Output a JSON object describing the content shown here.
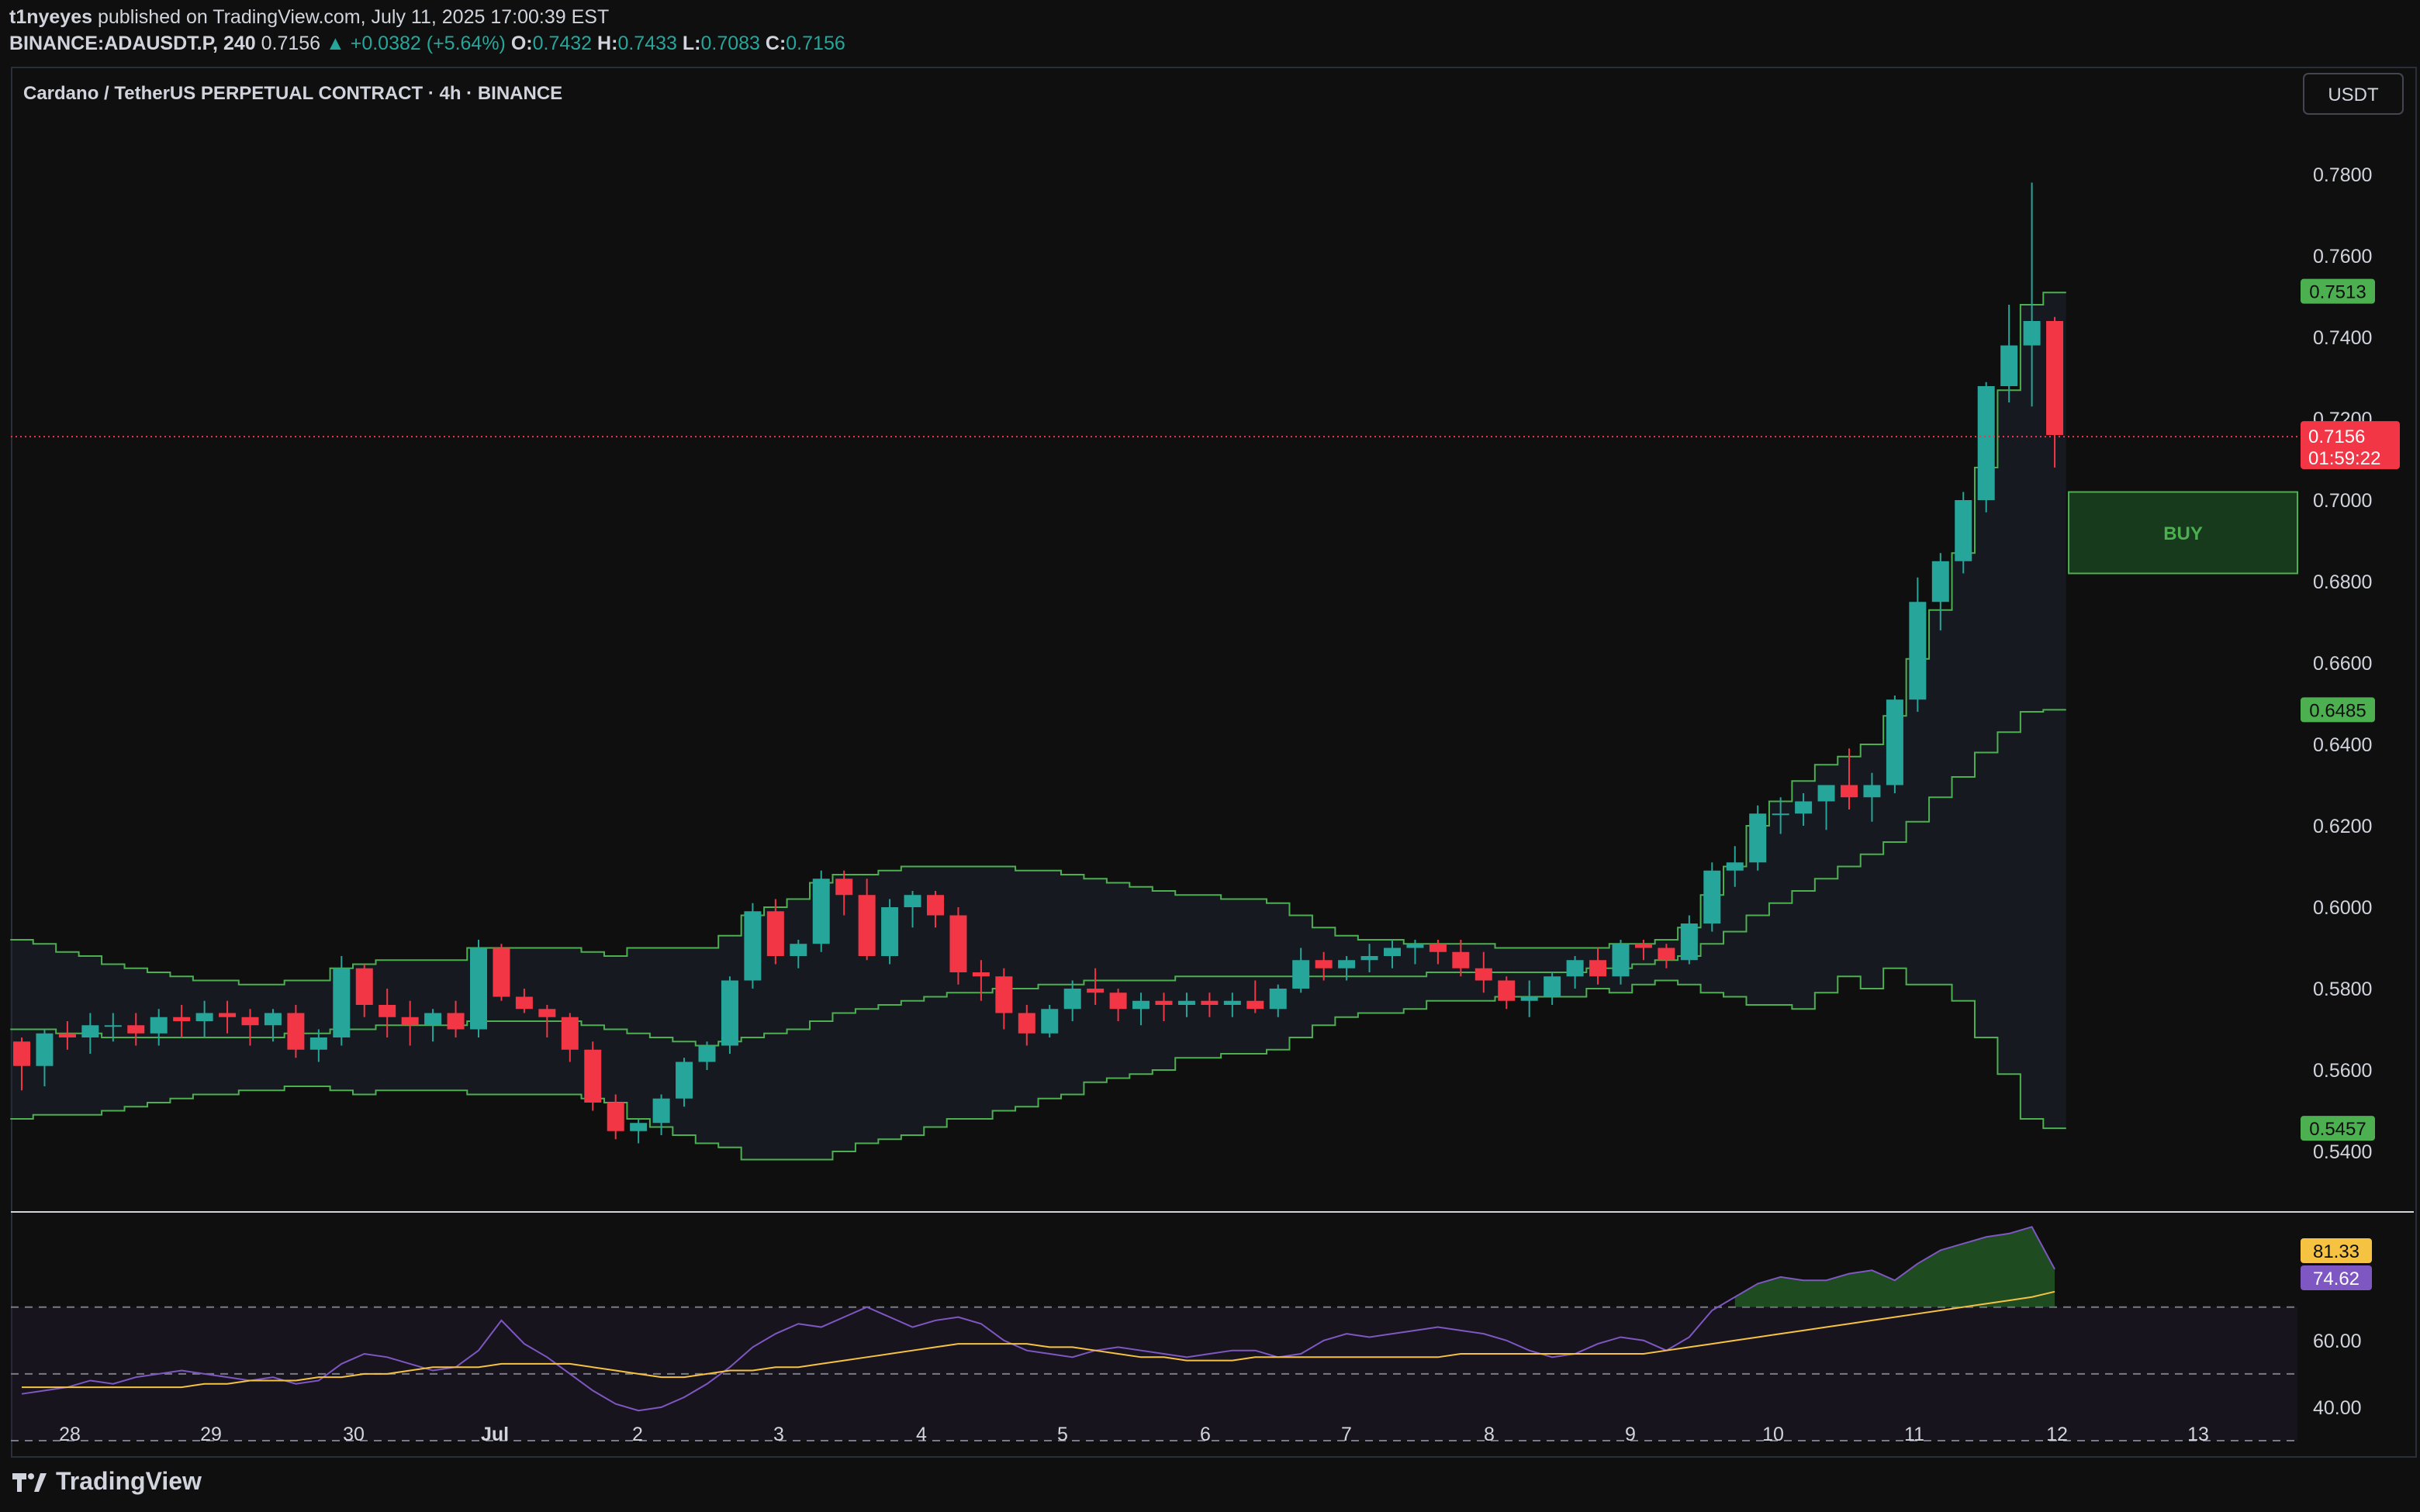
{
  "header": {
    "author": "t1nyeyes",
    "published": "published on TradingView.com, July 11, 2025 17:00:39 EST",
    "symbol_interval": "BINANCE:ADAUSDT.P, 240",
    "last": "0.7156",
    "change": "▲ +0.0382 (+5.64%)",
    "o_label": "O:",
    "o_value": "0.7432",
    "h_label": "H:",
    "h_value": "0.7433",
    "l_label": "L:",
    "l_value": "0.7083",
    "c_label": "C:",
    "c_value": "0.7156"
  },
  "pane_title": "Cardano / TetherUS PERPETUAL CONTRACT · 4h · BINANCE",
  "currency_button": "USDT",
  "price_scale": [
    "0.7800",
    "0.7600",
    "0.7400",
    "0.7200",
    "0.7000",
    "0.6800",
    "0.6600",
    "0.6400",
    "0.6200",
    "0.6000",
    "0.5800",
    "0.5600",
    "0.5400"
  ],
  "price_tags": {
    "upper_band": "0.7513",
    "last_price": "0.7156",
    "countdown": "01:59:22",
    "middle_band": "0.6485",
    "lower_band": "0.5457"
  },
  "buy_label": "BUY",
  "rsi_scale": [
    "60.00",
    "40.00"
  ],
  "rsi_tags": {
    "rsi": "81.33",
    "rsi_ma": "74.62"
  },
  "time_axis": [
    "28",
    "29",
    "30",
    "Jul",
    "2",
    "3",
    "4",
    "5",
    "6",
    "7",
    "8",
    "9",
    "10",
    "11",
    "12",
    "13"
  ],
  "footer": {
    "brand": "TradingView"
  },
  "colors": {
    "up": "#26a69a",
    "down": "#f23645",
    "band": "#4caf50",
    "rsi": "#7e57c2",
    "rsi_ma": "#f5c242",
    "background": "#0f0f0f"
  },
  "chart_data": [
    {
      "type": "candlestick",
      "title": "Cardano / TetherUS PERPETUAL CONTRACT · 4h · BINANCE",
      "ylim": [
        0.53,
        0.795
      ],
      "x_labels": [
        "28",
        "29",
        "30",
        "Jul",
        "2",
        "3",
        "4",
        "5",
        "6",
        "7",
        "8",
        "9",
        "10",
        "11",
        "12",
        "13"
      ],
      "candles": [
        [
          0.567,
          0.568,
          0.555,
          0.561
        ],
        [
          0.561,
          0.57,
          0.556,
          0.569
        ],
        [
          0.569,
          0.572,
          0.565,
          0.568
        ],
        [
          0.568,
          0.574,
          0.564,
          0.571
        ],
        [
          0.571,
          0.574,
          0.567,
          0.571
        ],
        [
          0.571,
          0.574,
          0.566,
          0.569
        ],
        [
          0.569,
          0.575,
          0.566,
          0.573
        ],
        [
          0.573,
          0.576,
          0.568,
          0.572
        ],
        [
          0.572,
          0.577,
          0.568,
          0.574
        ],
        [
          0.574,
          0.577,
          0.569,
          0.573
        ],
        [
          0.573,
          0.575,
          0.566,
          0.571
        ],
        [
          0.571,
          0.575,
          0.567,
          0.574
        ],
        [
          0.574,
          0.576,
          0.563,
          0.565
        ],
        [
          0.565,
          0.57,
          0.562,
          0.568
        ],
        [
          0.568,
          0.588,
          0.566,
          0.585
        ],
        [
          0.585,
          0.586,
          0.573,
          0.576
        ],
        [
          0.576,
          0.58,
          0.568,
          0.573
        ],
        [
          0.573,
          0.577,
          0.566,
          0.571
        ],
        [
          0.571,
          0.575,
          0.567,
          0.574
        ],
        [
          0.574,
          0.577,
          0.568,
          0.57
        ],
        [
          0.57,
          0.592,
          0.568,
          0.59
        ],
        [
          0.59,
          0.591,
          0.577,
          0.578
        ],
        [
          0.578,
          0.58,
          0.574,
          0.575
        ],
        [
          0.575,
          0.576,
          0.568,
          0.573
        ],
        [
          0.573,
          0.574,
          0.562,
          0.565
        ],
        [
          0.565,
          0.567,
          0.55,
          0.552
        ],
        [
          0.552,
          0.554,
          0.543,
          0.545
        ],
        [
          0.545,
          0.548,
          0.542,
          0.547
        ],
        [
          0.547,
          0.554,
          0.544,
          0.553
        ],
        [
          0.553,
          0.563,
          0.551,
          0.562
        ],
        [
          0.562,
          0.567,
          0.56,
          0.566
        ],
        [
          0.566,
          0.583,
          0.564,
          0.582
        ],
        [
          0.582,
          0.601,
          0.58,
          0.599
        ],
        [
          0.599,
          0.602,
          0.586,
          0.588
        ],
        [
          0.588,
          0.592,
          0.585,
          0.591
        ],
        [
          0.591,
          0.609,
          0.589,
          0.607
        ],
        [
          0.607,
          0.609,
          0.598,
          0.603
        ],
        [
          0.603,
          0.607,
          0.587,
          0.588
        ],
        [
          0.588,
          0.602,
          0.586,
          0.6
        ],
        [
          0.6,
          0.604,
          0.595,
          0.603
        ],
        [
          0.603,
          0.604,
          0.595,
          0.598
        ],
        [
          0.598,
          0.6,
          0.581,
          0.584
        ],
        [
          0.584,
          0.587,
          0.577,
          0.583
        ],
        [
          0.583,
          0.585,
          0.57,
          0.574
        ],
        [
          0.574,
          0.576,
          0.566,
          0.569
        ],
        [
          0.569,
          0.576,
          0.568,
          0.575
        ],
        [
          0.575,
          0.582,
          0.572,
          0.58
        ],
        [
          0.58,
          0.585,
          0.576,
          0.579
        ],
        [
          0.579,
          0.58,
          0.572,
          0.575
        ],
        [
          0.575,
          0.579,
          0.571,
          0.577
        ],
        [
          0.577,
          0.579,
          0.572,
          0.576
        ],
        [
          0.576,
          0.579,
          0.573,
          0.577
        ],
        [
          0.577,
          0.579,
          0.573,
          0.576
        ],
        [
          0.576,
          0.579,
          0.573,
          0.577
        ],
        [
          0.577,
          0.582,
          0.574,
          0.575
        ],
        [
          0.575,
          0.581,
          0.573,
          0.58
        ],
        [
          0.58,
          0.59,
          0.579,
          0.587
        ],
        [
          0.587,
          0.589,
          0.582,
          0.585
        ],
        [
          0.585,
          0.588,
          0.582,
          0.587
        ],
        [
          0.587,
          0.591,
          0.584,
          0.588
        ],
        [
          0.588,
          0.592,
          0.585,
          0.59
        ],
        [
          0.59,
          0.592,
          0.586,
          0.591
        ],
        [
          0.591,
          0.592,
          0.586,
          0.589
        ],
        [
          0.589,
          0.592,
          0.583,
          0.585
        ],
        [
          0.585,
          0.589,
          0.579,
          0.582
        ],
        [
          0.582,
          0.583,
          0.575,
          0.577
        ],
        [
          0.577,
          0.582,
          0.573,
          0.578
        ],
        [
          0.578,
          0.584,
          0.576,
          0.583
        ],
        [
          0.583,
          0.588,
          0.58,
          0.587
        ],
        [
          0.587,
          0.59,
          0.581,
          0.583
        ],
        [
          0.583,
          0.592,
          0.581,
          0.591
        ],
        [
          0.591,
          0.592,
          0.587,
          0.59
        ],
        [
          0.59,
          0.591,
          0.585,
          0.587
        ],
        [
          0.587,
          0.598,
          0.586,
          0.596
        ],
        [
          0.596,
          0.611,
          0.594,
          0.609
        ],
        [
          0.609,
          0.615,
          0.605,
          0.611
        ],
        [
          0.611,
          0.625,
          0.609,
          0.623
        ],
        [
          0.623,
          0.627,
          0.618,
          0.623
        ],
        [
          0.623,
          0.628,
          0.62,
          0.626
        ],
        [
          0.626,
          0.63,
          0.619,
          0.63
        ],
        [
          0.63,
          0.639,
          0.624,
          0.627
        ],
        [
          0.627,
          0.633,
          0.621,
          0.63
        ],
        [
          0.63,
          0.652,
          0.628,
          0.651
        ],
        [
          0.651,
          0.681,
          0.648,
          0.675
        ],
        [
          0.675,
          0.687,
          0.668,
          0.685
        ],
        [
          0.685,
          0.702,
          0.682,
          0.7
        ],
        [
          0.7,
          0.729,
          0.697,
          0.728
        ],
        [
          0.728,
          0.748,
          0.724,
          0.738
        ],
        [
          0.738,
          0.778,
          0.723,
          0.744
        ],
        [
          0.744,
          0.745,
          0.708,
          0.716
        ]
      ],
      "bollinger": {
        "upper": [
          0.592,
          0.591,
          0.589,
          0.588,
          0.586,
          0.585,
          0.584,
          0.583,
          0.582,
          0.582,
          0.581,
          0.581,
          0.582,
          0.582,
          0.585,
          0.586,
          0.587,
          0.587,
          0.587,
          0.587,
          0.59,
          0.59,
          0.59,
          0.59,
          0.59,
          0.589,
          0.588,
          0.59,
          0.59,
          0.59,
          0.59,
          0.593,
          0.598,
          0.6,
          0.602,
          0.606,
          0.608,
          0.608,
          0.609,
          0.61,
          0.61,
          0.61,
          0.61,
          0.61,
          0.609,
          0.609,
          0.608,
          0.607,
          0.606,
          0.605,
          0.604,
          0.603,
          0.603,
          0.602,
          0.602,
          0.601,
          0.598,
          0.595,
          0.593,
          0.592,
          0.592,
          0.591,
          0.591,
          0.591,
          0.591,
          0.59,
          0.59,
          0.59,
          0.59,
          0.59,
          0.591,
          0.591,
          0.592,
          0.595,
          0.603,
          0.61,
          0.62,
          0.626,
          0.631,
          0.635,
          0.637,
          0.64,
          0.647,
          0.661,
          0.673,
          0.687,
          0.708,
          0.727,
          0.748,
          0.751
        ],
        "middle": [
          0.57,
          0.57,
          0.569,
          0.569,
          0.568,
          0.568,
          0.568,
          0.568,
          0.568,
          0.568,
          0.568,
          0.568,
          0.569,
          0.569,
          0.57,
          0.57,
          0.571,
          0.571,
          0.571,
          0.571,
          0.572,
          0.572,
          0.572,
          0.572,
          0.572,
          0.571,
          0.57,
          0.569,
          0.568,
          0.567,
          0.566,
          0.567,
          0.568,
          0.569,
          0.57,
          0.572,
          0.574,
          0.575,
          0.576,
          0.577,
          0.578,
          0.579,
          0.579,
          0.58,
          0.58,
          0.581,
          0.581,
          0.582,
          0.582,
          0.582,
          0.582,
          0.583,
          0.583,
          0.583,
          0.583,
          0.583,
          0.583,
          0.583,
          0.583,
          0.583,
          0.583,
          0.583,
          0.584,
          0.584,
          0.584,
          0.584,
          0.584,
          0.584,
          0.584,
          0.585,
          0.585,
          0.586,
          0.587,
          0.588,
          0.591,
          0.594,
          0.598,
          0.601,
          0.604,
          0.607,
          0.61,
          0.613,
          0.616,
          0.621,
          0.627,
          0.632,
          0.638,
          0.643,
          0.648,
          0.6485
        ],
        "lower": [
          0.548,
          0.549,
          0.549,
          0.549,
          0.55,
          0.551,
          0.552,
          0.553,
          0.554,
          0.554,
          0.555,
          0.555,
          0.556,
          0.556,
          0.555,
          0.554,
          0.555,
          0.555,
          0.555,
          0.555,
          0.554,
          0.554,
          0.554,
          0.554,
          0.554,
          0.553,
          0.552,
          0.548,
          0.546,
          0.544,
          0.542,
          0.541,
          0.538,
          0.538,
          0.538,
          0.538,
          0.54,
          0.542,
          0.543,
          0.544,
          0.546,
          0.548,
          0.548,
          0.55,
          0.551,
          0.553,
          0.554,
          0.557,
          0.558,
          0.559,
          0.56,
          0.563,
          0.563,
          0.564,
          0.564,
          0.565,
          0.568,
          0.571,
          0.573,
          0.574,
          0.574,
          0.575,
          0.577,
          0.577,
          0.577,
          0.578,
          0.578,
          0.578,
          0.578,
          0.58,
          0.579,
          0.581,
          0.582,
          0.581,
          0.579,
          0.578,
          0.576,
          0.576,
          0.575,
          0.579,
          0.583,
          0.58,
          0.585,
          0.581,
          0.581,
          0.577,
          0.568,
          0.559,
          0.548,
          0.5457
        ]
      }
    },
    {
      "type": "line",
      "ylim": [
        30,
        95
      ],
      "y_labels": [
        "60.00",
        "40.00"
      ],
      "series": [
        {
          "values": [
            44,
            45,
            46,
            48,
            47,
            49,
            50,
            51,
            50,
            49,
            48,
            49,
            47,
            48,
            53,
            56,
            55,
            53,
            51,
            52,
            57,
            66,
            59,
            55,
            50,
            45,
            41,
            39,
            40,
            43,
            47,
            52,
            58,
            62,
            65,
            64,
            67,
            70,
            67,
            64,
            66,
            67,
            65,
            60,
            57,
            56,
            55,
            57,
            58,
            57,
            56,
            55,
            56,
            57,
            57,
            55,
            56,
            60,
            62,
            61,
            62,
            63,
            64,
            63,
            62,
            60,
            57,
            55,
            56,
            59,
            61,
            60,
            57,
            61,
            69,
            73,
            77,
            79,
            78,
            78,
            80,
            81,
            78,
            83,
            87,
            89,
            91,
            92,
            94,
            81.33
          ]
        },
        {
          "values": [
            46,
            46,
            46,
            46,
            46,
            46,
            46,
            46,
            47,
            47,
            48,
            48,
            48,
            49,
            49,
            50,
            50,
            51,
            52,
            52,
            52,
            53,
            53,
            53,
            53,
            52,
            51,
            50,
            49,
            49,
            50,
            51,
            51,
            52,
            52,
            53,
            54,
            55,
            56,
            57,
            58,
            59,
            59,
            59,
            59,
            58,
            58,
            57,
            56,
            55,
            55,
            54,
            54,
            54,
            55,
            55,
            55,
            55,
            55,
            55,
            55,
            55,
            55,
            56,
            56,
            56,
            56,
            56,
            56,
            56,
            56,
            56,
            57,
            58,
            59,
            60,
            61,
            62,
            63,
            64,
            65,
            66,
            67,
            68,
            69,
            70,
            71,
            72,
            73,
            74.62
          ]
        }
      ]
    }
  ]
}
